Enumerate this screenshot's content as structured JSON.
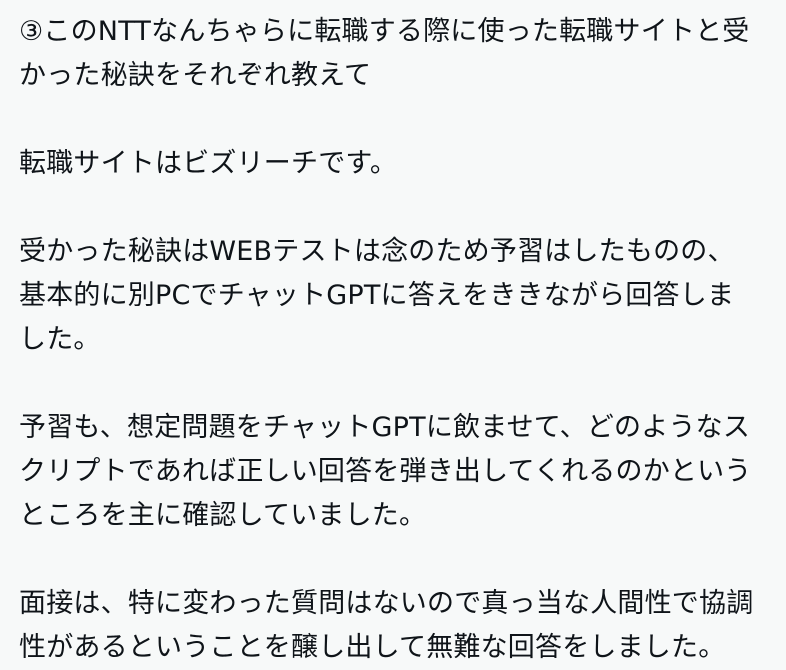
{
  "post": {
    "paragraphs": [
      "③このNTTなんちゃらに転職する際に使った転職サイトと受\nかった秘訣をそれぞれ教えて",
      "転職サイトはビズリーチです。",
      "受かった秘訣はWEBテストは念のため予習はしたものの、\n基本的に別PCでチャットGPTに答えをききながら回答しま\nした。",
      "予習も、想定問題をチャットGPTに飲ませて、どのようなス\nクリプトであれば正しい回答を弾き出してくれるのかという\nところを主に確認していました。",
      "面接は、特に変わった質問はないので真っ当な人間性で協調\n性があるということを醸し出して無難な回答をしました。"
    ]
  }
}
